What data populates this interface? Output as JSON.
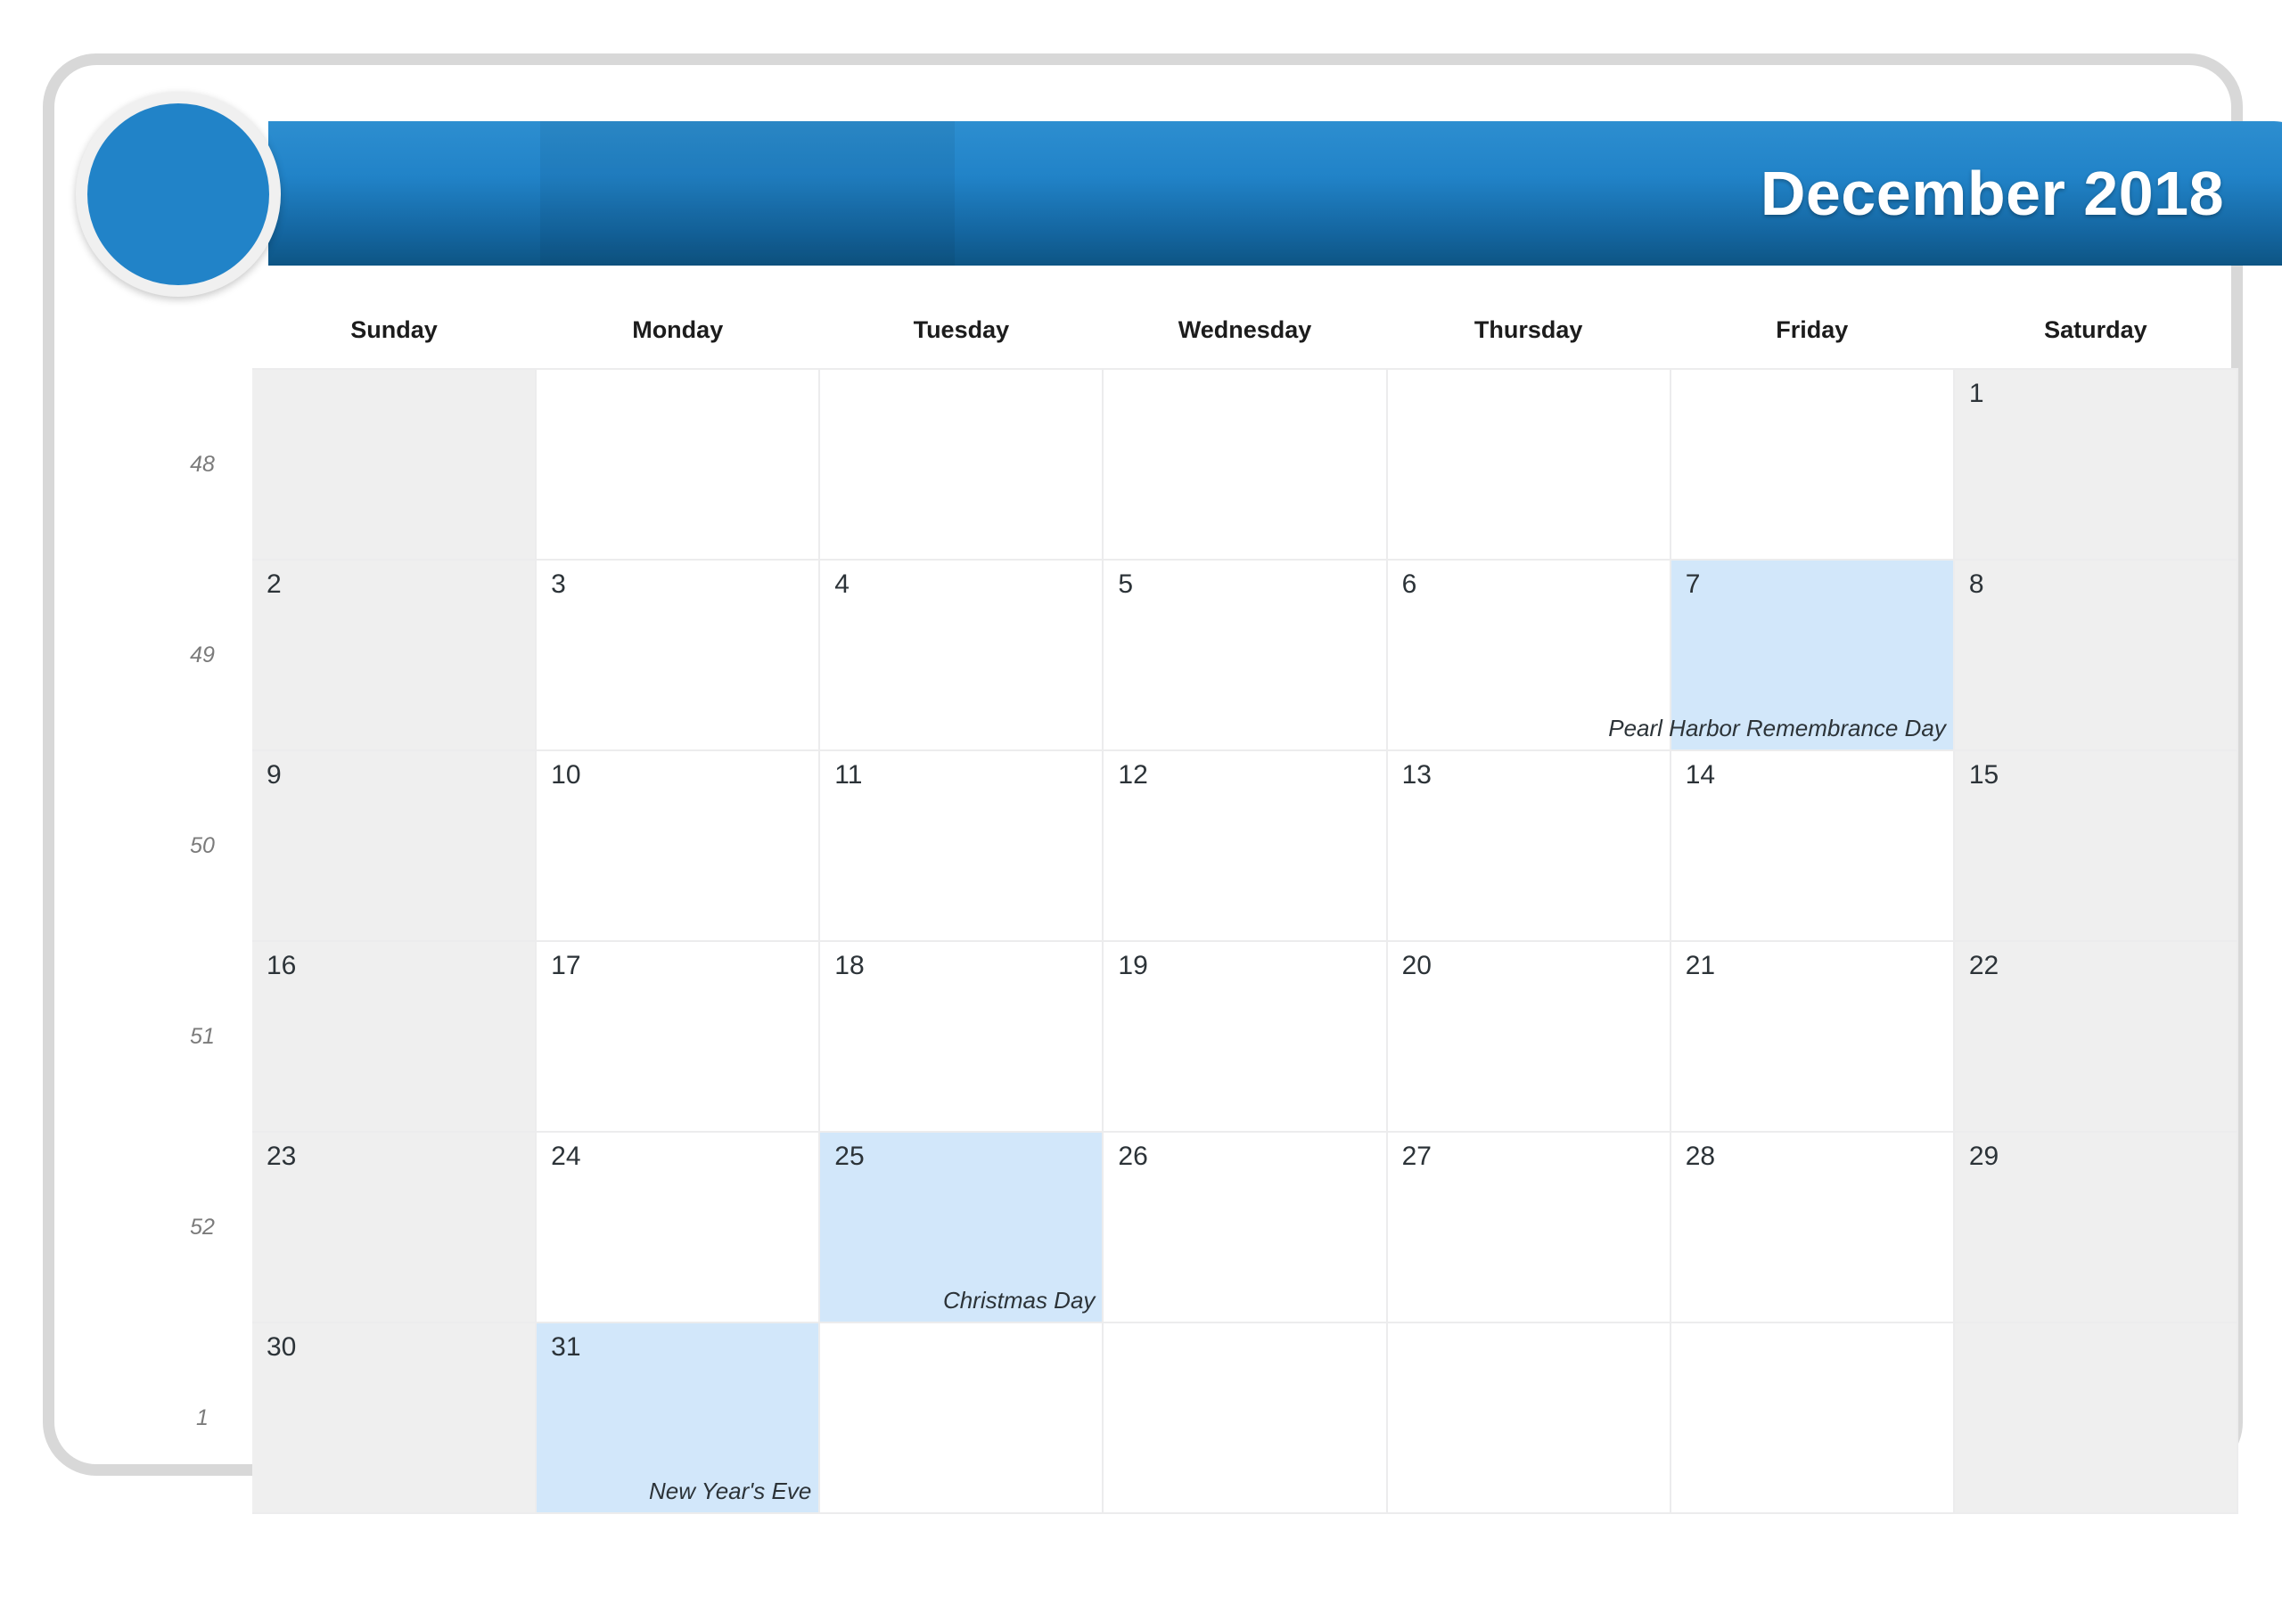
{
  "header": {
    "title": "December 2018",
    "badge_name": "circle-badge"
  },
  "weekdays": [
    "Sunday",
    "Monday",
    "Tuesday",
    "Wednesday",
    "Thursday",
    "Friday",
    "Saturday"
  ],
  "weeks": [
    {
      "week_number": "48",
      "days": [
        {
          "num": "",
          "event": "",
          "weekend": true,
          "holiday": false
        },
        {
          "num": "",
          "event": "",
          "weekend": false,
          "holiday": false
        },
        {
          "num": "",
          "event": "",
          "weekend": false,
          "holiday": false
        },
        {
          "num": "",
          "event": "",
          "weekend": false,
          "holiday": false
        },
        {
          "num": "",
          "event": "",
          "weekend": false,
          "holiday": false
        },
        {
          "num": "",
          "event": "",
          "weekend": false,
          "holiday": false
        },
        {
          "num": "1",
          "event": "",
          "weekend": true,
          "holiday": false
        }
      ]
    },
    {
      "week_number": "49",
      "days": [
        {
          "num": "2",
          "event": "",
          "weekend": true,
          "holiday": false
        },
        {
          "num": "3",
          "event": "",
          "weekend": false,
          "holiday": false
        },
        {
          "num": "4",
          "event": "",
          "weekend": false,
          "holiday": false
        },
        {
          "num": "5",
          "event": "",
          "weekend": false,
          "holiday": false
        },
        {
          "num": "6",
          "event": "",
          "weekend": false,
          "holiday": false
        },
        {
          "num": "7",
          "event": "Pearl Harbor Remembrance Day",
          "weekend": false,
          "holiday": true
        },
        {
          "num": "8",
          "event": "",
          "weekend": true,
          "holiday": false
        }
      ]
    },
    {
      "week_number": "50",
      "days": [
        {
          "num": "9",
          "event": "",
          "weekend": true,
          "holiday": false
        },
        {
          "num": "10",
          "event": "",
          "weekend": false,
          "holiday": false
        },
        {
          "num": "11",
          "event": "",
          "weekend": false,
          "holiday": false
        },
        {
          "num": "12",
          "event": "",
          "weekend": false,
          "holiday": false
        },
        {
          "num": "13",
          "event": "",
          "weekend": false,
          "holiday": false
        },
        {
          "num": "14",
          "event": "",
          "weekend": false,
          "holiday": false
        },
        {
          "num": "15",
          "event": "",
          "weekend": true,
          "holiday": false
        }
      ]
    },
    {
      "week_number": "51",
      "days": [
        {
          "num": "16",
          "event": "",
          "weekend": true,
          "holiday": false
        },
        {
          "num": "17",
          "event": "",
          "weekend": false,
          "holiday": false
        },
        {
          "num": "18",
          "event": "",
          "weekend": false,
          "holiday": false
        },
        {
          "num": "19",
          "event": "",
          "weekend": false,
          "holiday": false
        },
        {
          "num": "20",
          "event": "",
          "weekend": false,
          "holiday": false
        },
        {
          "num": "21",
          "event": "",
          "weekend": false,
          "holiday": false
        },
        {
          "num": "22",
          "event": "",
          "weekend": true,
          "holiday": false
        }
      ]
    },
    {
      "week_number": "52",
      "days": [
        {
          "num": "23",
          "event": "",
          "weekend": true,
          "holiday": false
        },
        {
          "num": "24",
          "event": "",
          "weekend": false,
          "holiday": false
        },
        {
          "num": "25",
          "event": "Christmas Day",
          "weekend": false,
          "holiday": true
        },
        {
          "num": "26",
          "event": "",
          "weekend": false,
          "holiday": false
        },
        {
          "num": "27",
          "event": "",
          "weekend": false,
          "holiday": false
        },
        {
          "num": "28",
          "event": "",
          "weekend": false,
          "holiday": false
        },
        {
          "num": "29",
          "event": "",
          "weekend": true,
          "holiday": false
        }
      ]
    },
    {
      "week_number": "1",
      "days": [
        {
          "num": "30",
          "event": "",
          "weekend": true,
          "holiday": false
        },
        {
          "num": "31",
          "event": "New Year's Eve",
          "weekend": false,
          "holiday": true
        },
        {
          "num": "",
          "event": "",
          "weekend": false,
          "holiday": false
        },
        {
          "num": "",
          "event": "",
          "weekend": false,
          "holiday": false
        },
        {
          "num": "",
          "event": "",
          "weekend": false,
          "holiday": false
        },
        {
          "num": "",
          "event": "",
          "weekend": false,
          "holiday": false
        },
        {
          "num": "",
          "event": "",
          "weekend": true,
          "holiday": false
        }
      ]
    }
  ],
  "colors": {
    "banner_top": "#2d8ed0",
    "banner_bottom": "#0d5584",
    "holiday_bg": "#d2e7fa",
    "weekend_bg": "#efefef",
    "frame_border": "#d8d8d8",
    "grid_line": "#ececed"
  }
}
